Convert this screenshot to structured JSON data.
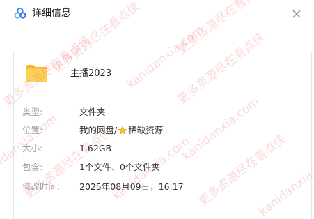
{
  "dialog": {
    "title": "详细信息",
    "app_icon": "baidu-netdisk-cloud-icon",
    "close_icon": "close-icon"
  },
  "file": {
    "name": "主播2023",
    "icon": "folder-icon"
  },
  "details": [
    {
      "label": "类型:",
      "value": "文件夹"
    },
    {
      "label": "位置:",
      "value_prefix": "我的网盘/",
      "value_icon": "star-icon",
      "value_suffix": "稀缺资源"
    },
    {
      "label": "大小:",
      "value": "1.62GB"
    },
    {
      "label": "包含:",
      "value": "1个文件、0个文件夹"
    },
    {
      "label": "修改时间:",
      "value": "2025年08月09日，16:17"
    }
  ],
  "watermarks": {
    "site": "kanidanxia.com",
    "slogan": "更多资源尽在看点侠"
  },
  "colors": {
    "accent": "#4a90e2",
    "folder": "#f7c64a",
    "watermark": "#e65050"
  }
}
